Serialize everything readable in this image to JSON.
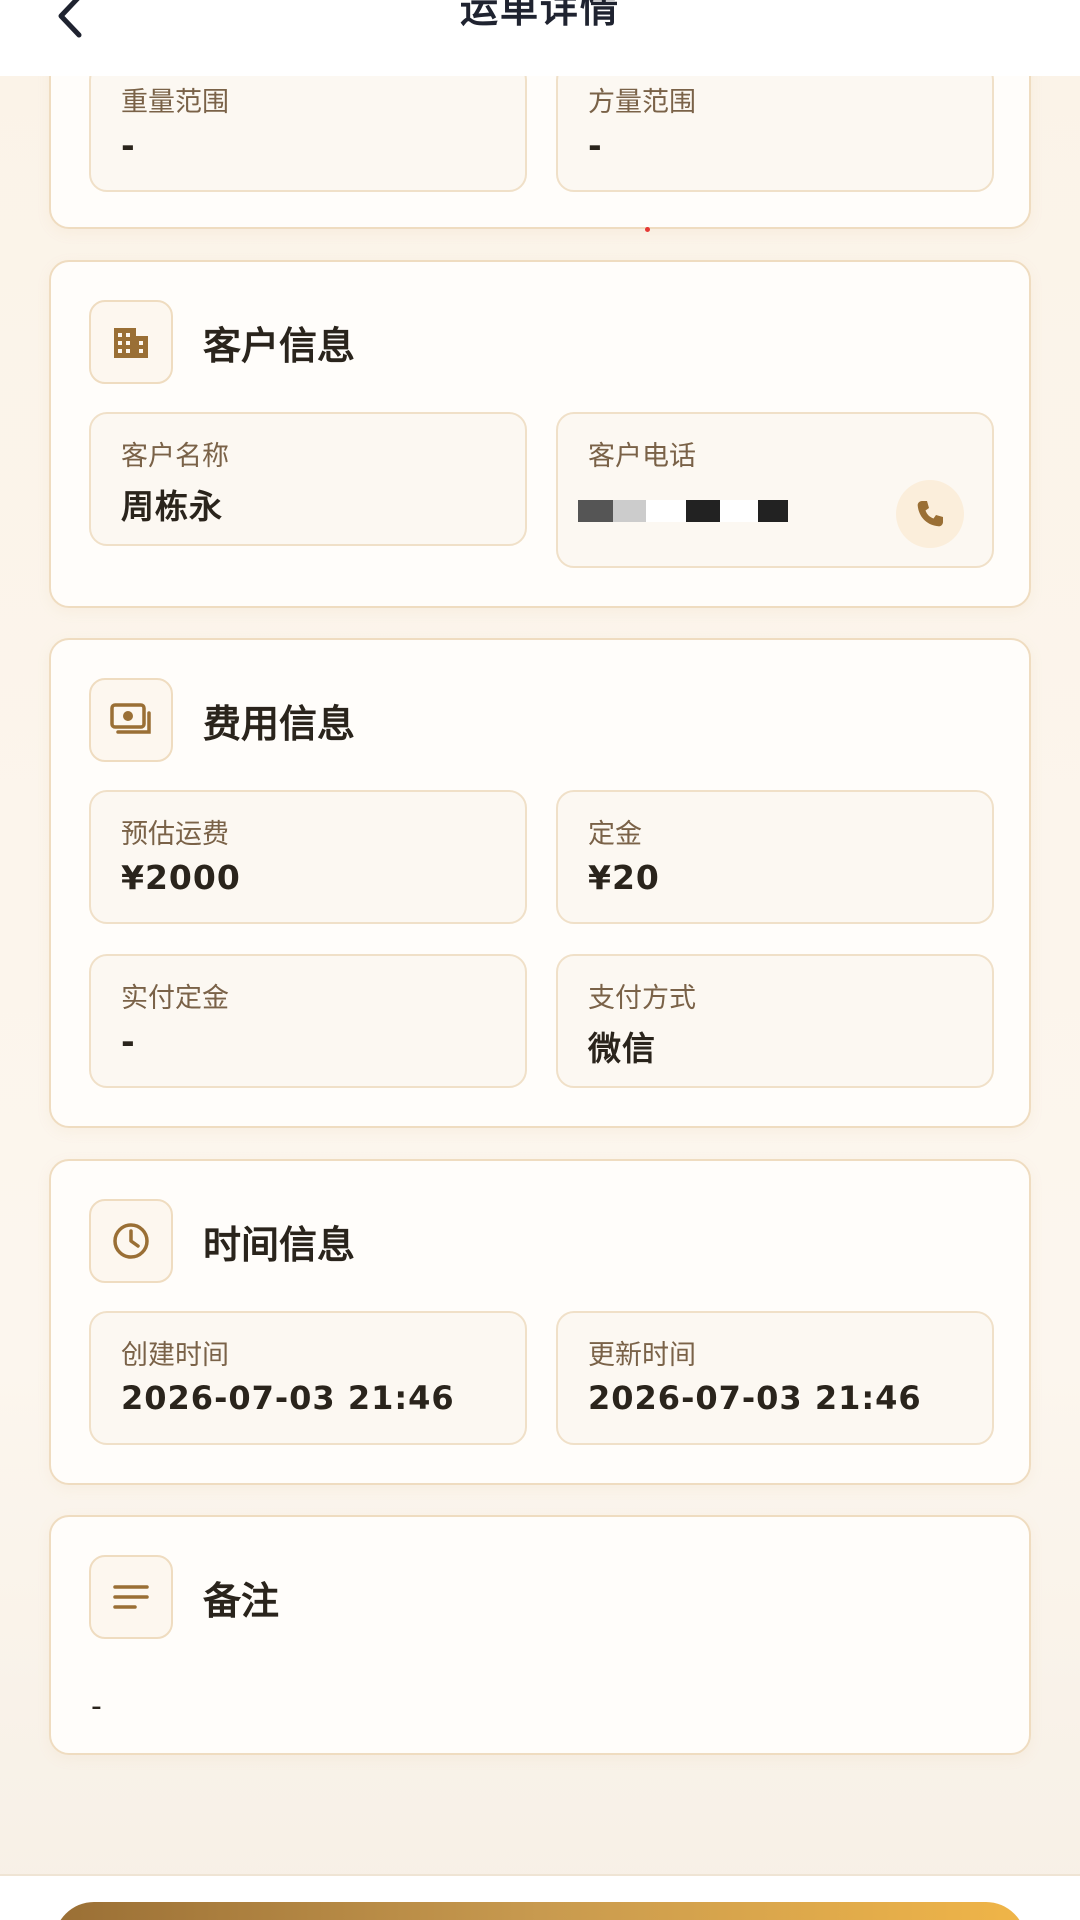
{
  "header": {
    "title": "运单详情"
  },
  "cargo": {
    "weight_range": {
      "label": "重量范围",
      "value": "-"
    },
    "volume_range": {
      "label": "方量范围",
      "value": "-"
    }
  },
  "customer": {
    "title": "客户信息",
    "icon": "building-icon",
    "name": {
      "label": "客户名称",
      "value": "周栋永"
    },
    "phone": {
      "label": "客户电话",
      "value": ""
    }
  },
  "fees": {
    "title": "费用信息",
    "icon": "money-icon",
    "estimated": {
      "label": "预估运费",
      "value": "¥2000"
    },
    "deposit": {
      "label": "定金",
      "value": "¥20"
    },
    "paid_deposit": {
      "label": "实付定金",
      "value": "-"
    },
    "payment_method": {
      "label": "支付方式",
      "value": "微信"
    }
  },
  "time": {
    "title": "时间信息",
    "icon": "clock-icon",
    "created": {
      "label": "创建时间",
      "value": "2026-07-03 21:46"
    },
    "updated": {
      "label": "更新时间",
      "value": "2026-07-03 21:46"
    }
  },
  "notes": {
    "title": "备注",
    "icon": "notes-icon",
    "value": "-"
  },
  "colors": {
    "accent": "#9a6f35",
    "card_border": "#efdcc0",
    "background": "#fcf5ec"
  }
}
